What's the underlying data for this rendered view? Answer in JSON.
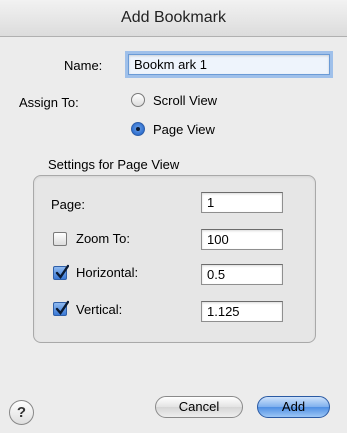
{
  "window": {
    "title": "Add Bookmark"
  },
  "name_field": {
    "label": "Name:",
    "value": "Bookm ark  1"
  },
  "assign_to": {
    "label": "Assign To:",
    "options": [
      {
        "label": "Scroll View",
        "selected": false
      },
      {
        "label": "Page View",
        "selected": true
      }
    ]
  },
  "settings": {
    "title": "Settings for Page View",
    "page": {
      "label": "Page:",
      "value": "1"
    },
    "zoom": {
      "label": "Zoom To:",
      "value": "100",
      "checked": false
    },
    "horizontal": {
      "label": "Horizontal:",
      "value": "0.5",
      "checked": true
    },
    "vertical": {
      "label": "Vertical:",
      "value": "1.125",
      "checked": true
    }
  },
  "buttons": {
    "help": "?",
    "cancel": "Cancel",
    "add": "Add"
  },
  "colors": {
    "accent": "#3a79d6",
    "focus_ring": "#9fc0ea"
  }
}
